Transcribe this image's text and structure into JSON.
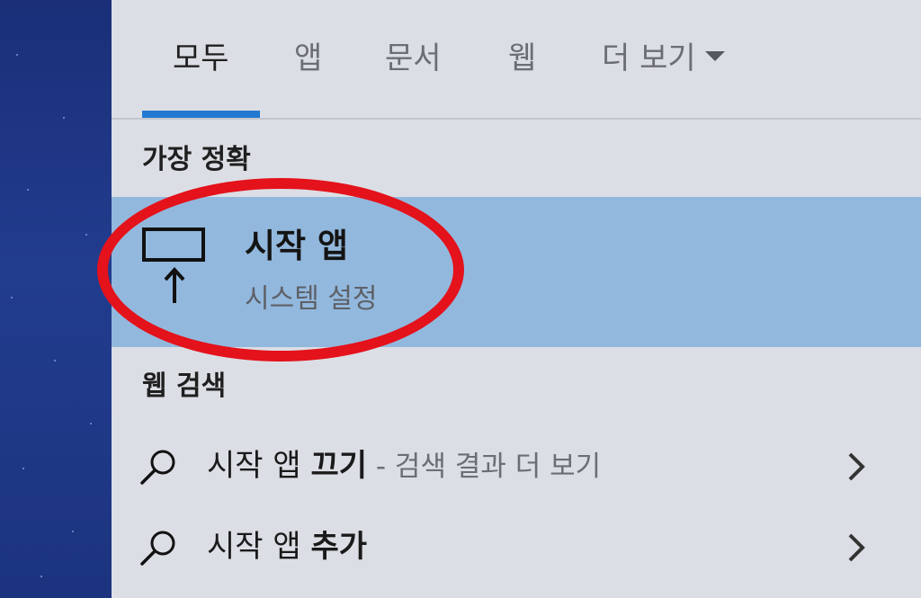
{
  "tabs": [
    {
      "label": "모두",
      "active": true
    },
    {
      "label": "앱",
      "active": false
    },
    {
      "label": "문서",
      "active": false
    },
    {
      "label": "웹",
      "active": false
    },
    {
      "label": "더 보기",
      "active": false
    }
  ],
  "best_match": {
    "section_label": "가장 정확",
    "title": "시작 앱",
    "subtitle": "시스템 설정",
    "icon": "display-arrow-icon"
  },
  "web_search": {
    "section_label": "웹 검색",
    "results": [
      {
        "query_plain": "시작 앱 ",
        "query_bold": "끄기",
        "suffix": " - 검색 결과 더 보기"
      },
      {
        "query_plain": "시작 앱 ",
        "query_bold": "추가",
        "suffix": ""
      }
    ]
  },
  "colors": {
    "accent": "#2179d0",
    "selected_row": "#93b8dd",
    "annotation_ring": "#e4121b"
  }
}
